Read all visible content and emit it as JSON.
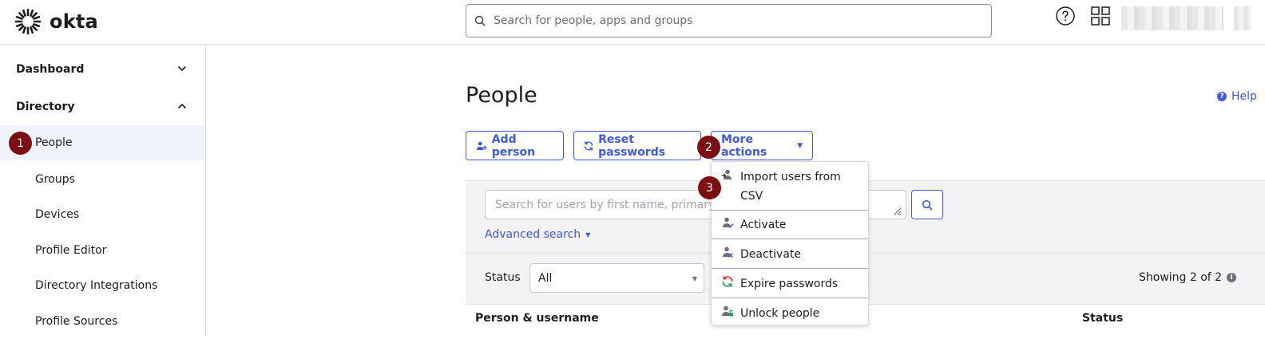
{
  "header": {
    "brand": "okta",
    "search_placeholder": "Search for people, apps and groups"
  },
  "sidebar": {
    "sections": [
      {
        "label": "Dashboard",
        "expanded": false
      },
      {
        "label": "Directory",
        "expanded": true
      }
    ],
    "items": [
      {
        "label": "People",
        "active": true
      },
      {
        "label": "Groups"
      },
      {
        "label": "Devices"
      },
      {
        "label": "Profile Editor"
      },
      {
        "label": "Directory Integrations"
      },
      {
        "label": "Profile Sources"
      }
    ]
  },
  "steps": [
    "1",
    "2",
    "3"
  ],
  "main": {
    "title": "People",
    "help_label": "Help",
    "buttons": {
      "add_person": "Add person",
      "reset_passwords": "Reset passwords",
      "more_actions": "More actions"
    },
    "search_placeholder": "Search for users by first name, primary email",
    "advanced_search": "Advanced search",
    "status_label": "Status",
    "status_value": "All",
    "showing": "Showing 2 of 2",
    "table_headers": [
      "Person & username",
      "Status"
    ]
  },
  "more_actions_menu": {
    "items": [
      {
        "line1": "Import users from",
        "line2": "CSV",
        "icon": "import-user-icon"
      },
      {
        "line1": "Activate",
        "icon": "activate-user-icon"
      },
      {
        "line1": "Deactivate",
        "icon": "deactivate-user-icon"
      },
      {
        "line1": "Expire passwords",
        "icon": "expire-passwords-icon"
      },
      {
        "line1": "Unlock people",
        "icon": "unlock-user-icon"
      }
    ]
  },
  "colors": {
    "accent": "#3f59e4",
    "step_badge": "#7a0f14",
    "active_nav": "#f1f3fb"
  }
}
